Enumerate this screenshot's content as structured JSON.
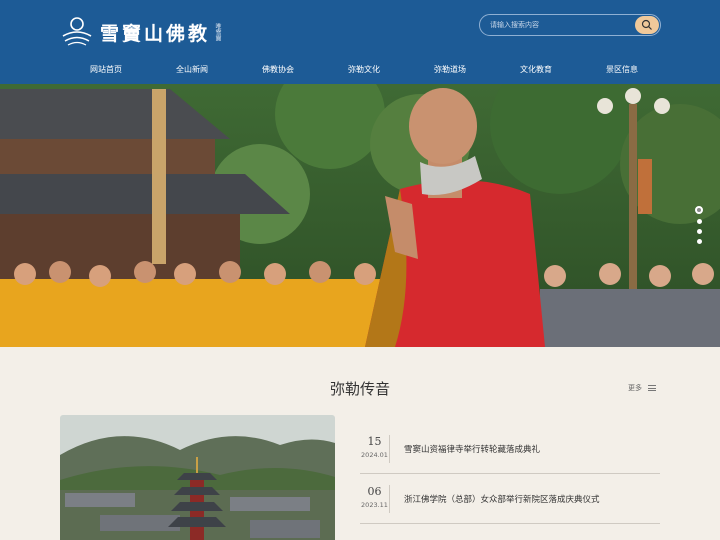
{
  "site": {
    "logo_text": "雪竇山佛教",
    "logo_small": "唯雪竇"
  },
  "search": {
    "placeholder": "请输入搜索内容",
    "button_icon": "search-icon"
  },
  "nav": [
    {
      "label": "网站首页"
    },
    {
      "label": "全山新闻"
    },
    {
      "label": "佛教协会"
    },
    {
      "label": "弥勒文化"
    },
    {
      "label": "弥勒道场"
    },
    {
      "label": "文化教育"
    },
    {
      "label": "景区信息"
    }
  ],
  "banner": {
    "slides": 4,
    "active_slide": 1
  },
  "section": {
    "title": "弥勒传音",
    "more_label": "更多"
  },
  "news": [
    {
      "day": "15",
      "ym": "2024.01",
      "title": "雪窦山资福律寺举行转轮藏落成典礼"
    },
    {
      "day": "06",
      "ym": "2023.11",
      "title": "浙江佛学院（总部）女众部举行新院区落成庆典仪式"
    }
  ],
  "colors": {
    "header_bg": "#1d5b96",
    "page_bg": "#f3efe8",
    "search_button": "#f0c99a"
  }
}
